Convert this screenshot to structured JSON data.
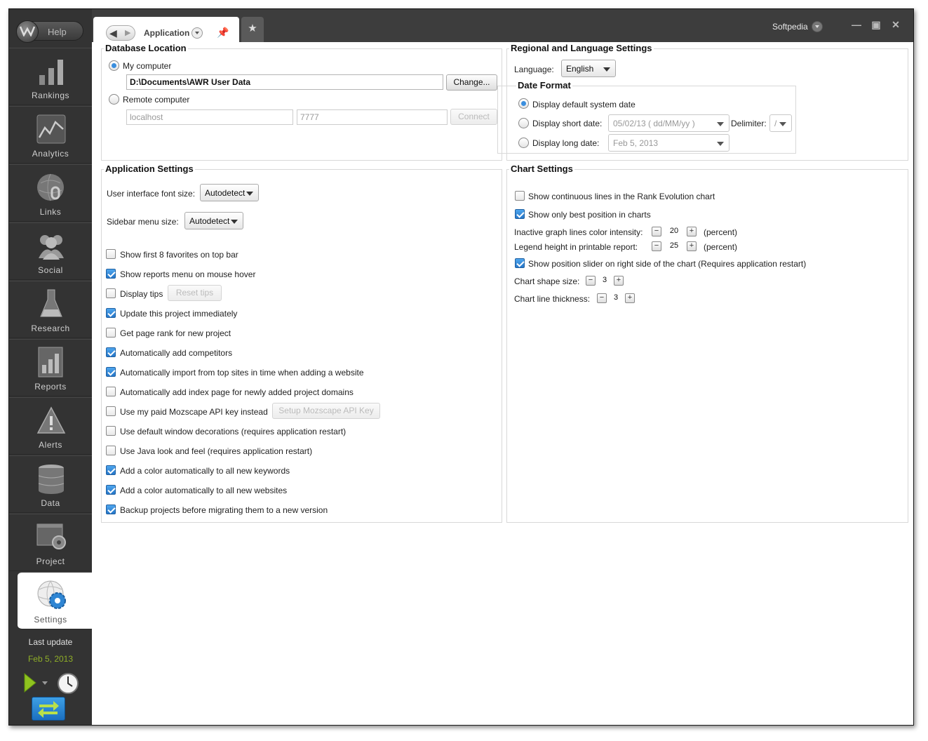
{
  "app": {
    "help_label": "Help",
    "user_name": "Softpedia",
    "tab_title": "Application"
  },
  "sidebar": {
    "items": [
      {
        "label": "Rankings"
      },
      {
        "label": "Analytics"
      },
      {
        "label": "Links"
      },
      {
        "label": "Social"
      },
      {
        "label": "Research"
      },
      {
        "label": "Reports"
      },
      {
        "label": "Alerts"
      },
      {
        "label": "Data"
      },
      {
        "label": "Project"
      },
      {
        "label": "Settings"
      }
    ],
    "last_update_label": "Last update",
    "last_update_date": "Feb 5, 2013"
  },
  "database": {
    "title": "Database Location",
    "my_computer_label": "My computer",
    "path_value": "D:\\Documents\\AWR User Data",
    "change_label": "Change...",
    "remote_label": "Remote computer",
    "host_value": "localhost",
    "port_value": "7777",
    "connect_label": "Connect"
  },
  "regional": {
    "title": "Regional and Language Settings",
    "language_label": "Language:",
    "language_value": "English",
    "date_format_title": "Date Format",
    "default_date_label": "Display default system date",
    "short_date_label": "Display short date:",
    "short_date_value": "05/02/13 ( dd/MM/yy )",
    "delimiter_label": "Delimiter:",
    "delimiter_value": "/",
    "long_date_label": "Display long date:",
    "long_date_value": "Feb 5, 2013"
  },
  "app_settings": {
    "title": "Application Settings",
    "font_size_label": "User interface font size:",
    "font_size_value": "Autodetect",
    "sidebar_size_label": "Sidebar menu size:",
    "sidebar_size_value": "Autodetect",
    "reset_tips_label": "Reset tips",
    "mozscape_btn_label": "Setup Mozscape API Key",
    "options": [
      {
        "label": "Show first 8 favorites on top bar",
        "checked": false
      },
      {
        "label": "Show reports menu on mouse hover",
        "checked": true
      },
      {
        "label": "Display tips",
        "checked": false
      },
      {
        "label": "Update this project immediately",
        "checked": true
      },
      {
        "label": "Get page rank for new project",
        "checked": false
      },
      {
        "label": "Automatically add competitors",
        "checked": true
      },
      {
        "label": "Automatically import from top sites in time when adding a website",
        "checked": true
      },
      {
        "label": "Automatically add index page for newly added project domains",
        "checked": false
      },
      {
        "label": "Use my paid Mozscape API key instead",
        "checked": false
      },
      {
        "label": "Use default window decorations (requires application restart)",
        "checked": false
      },
      {
        "label": "Use Java look and feel (requires application restart)",
        "checked": false
      },
      {
        "label": "Add a color automatically to all new keywords",
        "checked": true
      },
      {
        "label": "Add a color automatically to all new websites",
        "checked": true
      },
      {
        "label": "Backup projects before migrating them to a new version",
        "checked": true
      }
    ]
  },
  "chart_settings": {
    "title": "Chart Settings",
    "continuous_lines_label": "Show continuous lines in the Rank Evolution chart",
    "best_position_label": "Show only best position in charts",
    "inactive_intensity_label": "Inactive graph lines color intensity:",
    "inactive_intensity_value": "20",
    "legend_height_label": "Legend height in printable report:",
    "legend_height_value": "25",
    "percent_label": "(percent)",
    "slider_label": "Show position slider on right side of the chart (Requires application restart)",
    "shape_size_label": "Chart shape size:",
    "shape_size_value": "3",
    "line_thickness_label": "Chart line thickness:",
    "line_thickness_value": "3"
  }
}
